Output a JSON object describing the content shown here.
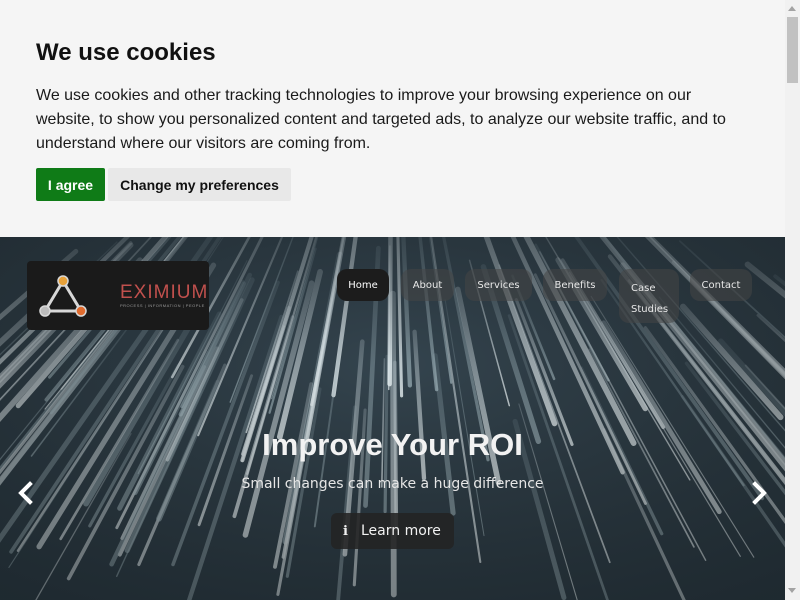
{
  "cookie_banner": {
    "title": "We use cookies",
    "text": "We use cookies and other tracking technologies to improve your browsing experience on our website, to show you personalized content and targeted ads, to analyze our website traffic, and to understand where our visitors are coming from.",
    "agree_label": "I agree",
    "prefs_label": "Change my preferences"
  },
  "logo": {
    "name": "EXIMIUM",
    "tagline": "PROCESS | INFORMATION | PEOPLE"
  },
  "nav": {
    "home": "Home",
    "about": "About",
    "services": "Services",
    "benefits": "Benefits",
    "case_line1": "Case",
    "case_line2": "Studies",
    "contact": "Contact"
  },
  "hero": {
    "heading": "Improve Your ROI",
    "subheading": "Small changes can make a huge difference",
    "cta_label": "Learn more",
    "cta_icon": "info-icon",
    "prev_icon": "chevron-left-icon",
    "next_icon": "chevron-right-icon"
  },
  "colors": {
    "agree_button": "#0f7b17",
    "logo_text": "#c0504d",
    "hero_bg": "#2d3b45"
  }
}
